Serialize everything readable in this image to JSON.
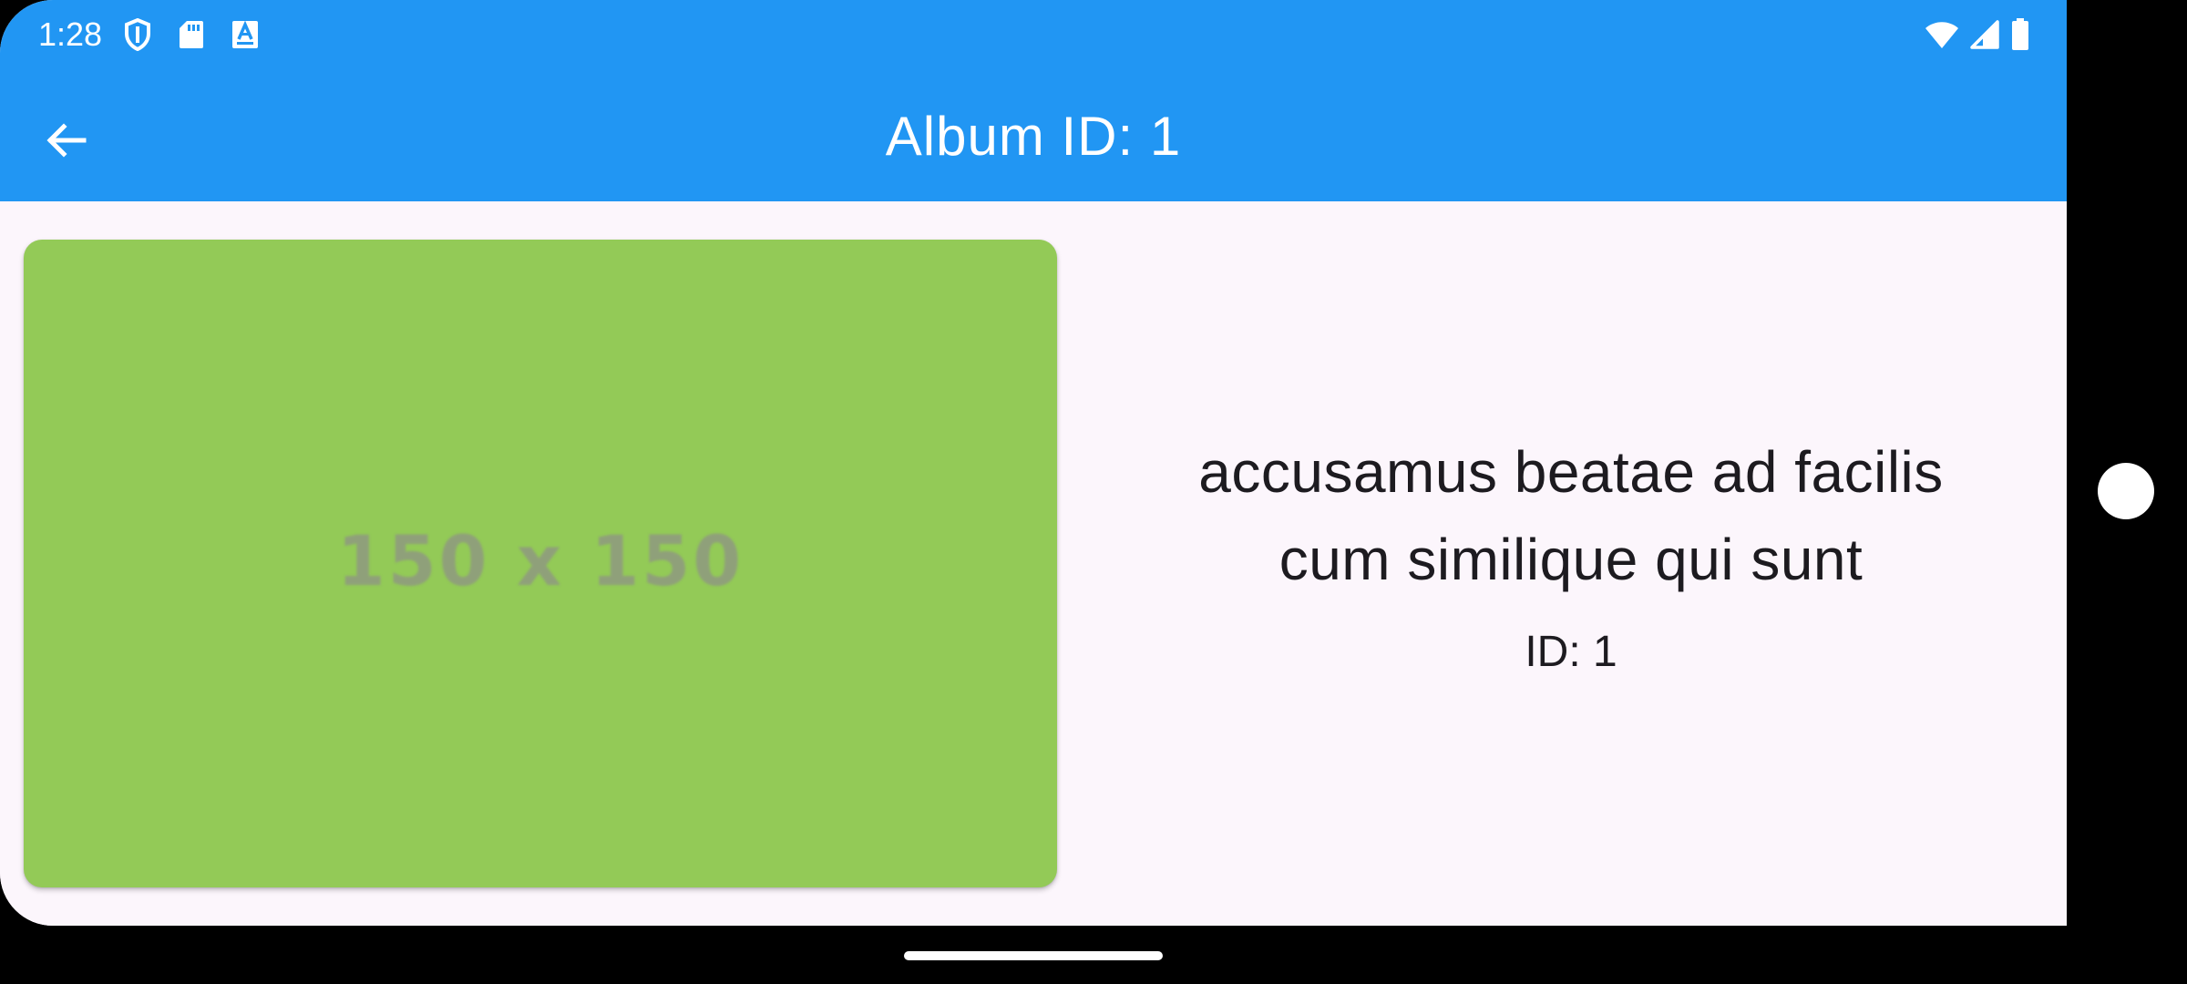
{
  "status_bar": {
    "time": "1:28",
    "left_icons": [
      "shield-icon",
      "sd-card-icon",
      "keyboard-a-icon"
    ],
    "right_icons": [
      "wifi-icon",
      "cell-signal-icon",
      "battery-icon"
    ],
    "background": "#2196F3"
  },
  "app_bar": {
    "title": "Album ID: 1",
    "back_icon": "arrow-back-icon",
    "background": "#2196F3"
  },
  "album": {
    "image_placeholder_text": "150 x 150",
    "image_color": "#93CA57",
    "title": "accusamus beatae ad facilis cum similique qui sunt",
    "id_label": "ID: 1"
  },
  "colors": {
    "page_background": "#FCF6FC",
    "text": "#1D1B20"
  }
}
